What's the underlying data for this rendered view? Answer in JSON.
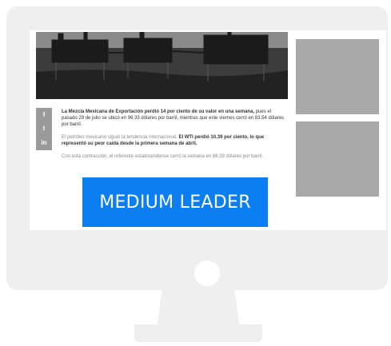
{
  "social": {
    "icons": [
      "facebook-icon",
      "twitter-icon",
      "linkedin-icon"
    ],
    "glyphs": [
      "f",
      "t",
      "in"
    ]
  },
  "article": {
    "p1_bold": "La Mezcla Mexicana de Exportación perdió 14 por ciento de su valor en una semana,",
    "p1_rest": " pues el pasado 29 de julio se ubicó en 96.33 dólares por barril, mientras que este viernes cerró en 83.54 dólares por barril.",
    "p2_plain": "El petróleo mexicano siguió la tendencia internacional. ",
    "p2_bold": "El WTI perdió 10.39 por ciento, lo que representó su peor caída desde la primera semana de abril.",
    "p3": "Con esta contracción, el referente estadounidense cerró la semana en 88.39 dólares por barril."
  },
  "ad": {
    "leader_label": "MEDIUM LEADER",
    "leader_color": "#0b7ef1",
    "placeholder_color": "#a9a9a9"
  }
}
